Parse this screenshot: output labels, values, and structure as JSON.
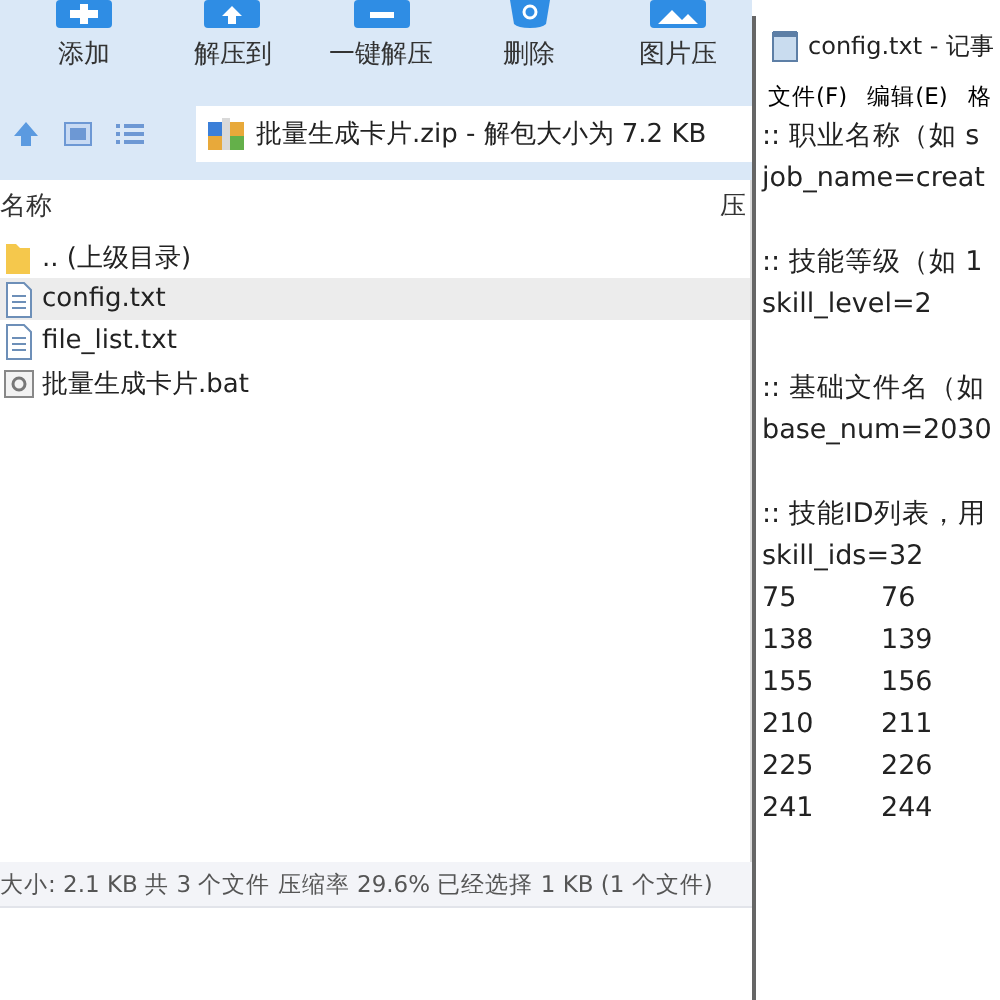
{
  "toolbar": {
    "items": [
      {
        "label": "添加",
        "kind": "add"
      },
      {
        "label": "解压到",
        "kind": "extract"
      },
      {
        "label": "一键解压",
        "kind": "oneclick"
      },
      {
        "label": "删除",
        "kind": "delete"
      },
      {
        "label": "图片压",
        "kind": "image"
      }
    ]
  },
  "address_bar": {
    "path": "批量生成卡片.zip - 解包大小为 7.2 KB"
  },
  "file_list": {
    "columns": [
      "名称",
      "压"
    ],
    "rows": [
      {
        "name": ".. (上级目录)",
        "kind": "folder",
        "selected": false
      },
      {
        "name": "config.txt",
        "kind": "text",
        "selected": true
      },
      {
        "name": "file_list.txt",
        "kind": "text",
        "selected": false
      },
      {
        "name": "批量生成卡片.bat",
        "kind": "batch",
        "selected": false
      }
    ]
  },
  "status_bar": "大小: 2.1 KB 共 3 个文件 压缩率 29.6% 已经选择 1 KB (1 个文件)",
  "notepad": {
    "title": "config.txt - 记事",
    "menu": [
      "文件(F)",
      "编辑(E)",
      "格"
    ],
    "paragraphs": [
      [
        ":: 职业名称（如 s",
        "job_name=creat"
      ],
      [
        ":: 技能等级（如 1",
        "skill_level=2"
      ],
      [
        ":: 基础文件名（如",
        "base_num=2030"
      ],
      [
        ":: 技能ID列表，用",
        "skill_ids=32"
      ]
    ],
    "id_rows": [
      [
        "75",
        "76"
      ],
      [
        "138",
        "139"
      ],
      [
        "155",
        "156"
      ],
      [
        "210",
        "211"
      ],
      [
        "225",
        "226"
      ],
      [
        "241",
        "244"
      ]
    ]
  }
}
